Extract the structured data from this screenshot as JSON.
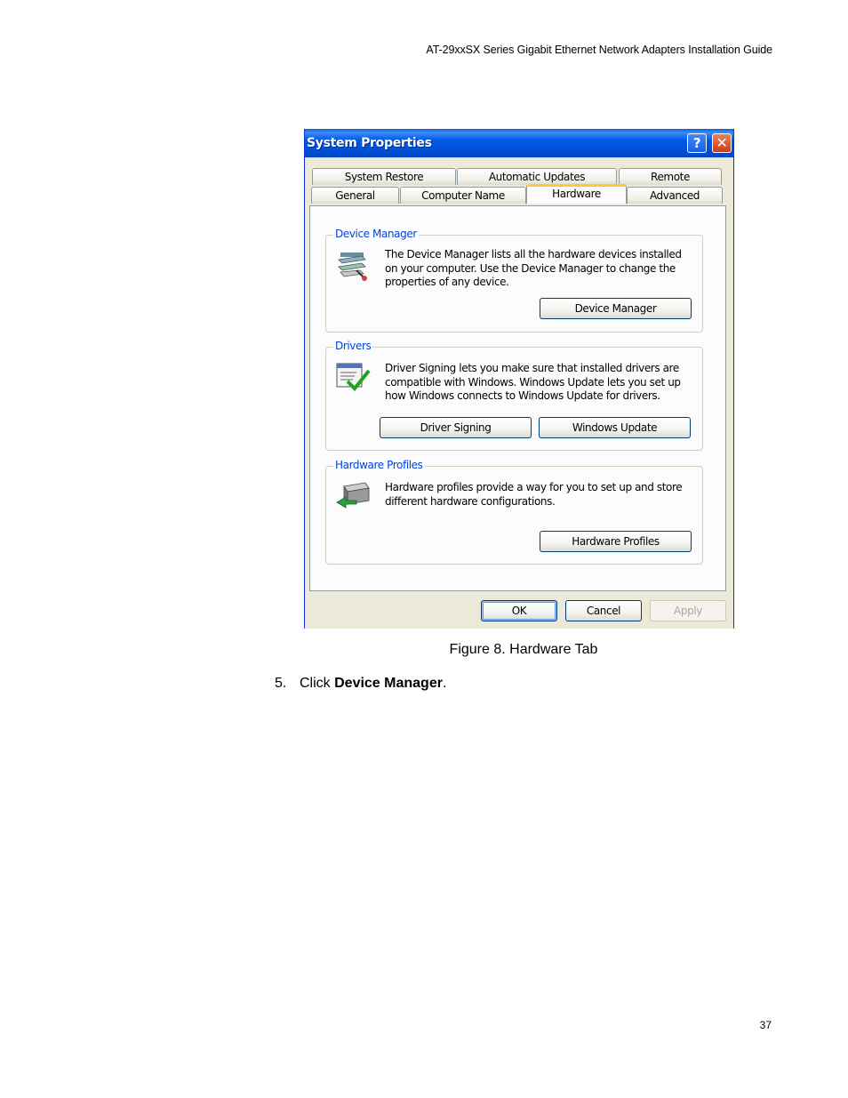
{
  "page": {
    "header": "AT-29xxSX Series Gigabit Ethernet Network Adapters Installation Guide",
    "caption": "Figure 8. Hardware Tab",
    "step_number": "5.",
    "step_prefix": "Click ",
    "step_bold": "Device Manager",
    "step_suffix": ".",
    "page_number": "37"
  },
  "dialog": {
    "title": "System Properties",
    "help_glyph": "?",
    "close_glyph": "✕",
    "tabs_row1": [
      "System Restore",
      "Automatic Updates",
      "Remote"
    ],
    "tabs_row2": [
      "General",
      "Computer Name",
      "Hardware",
      "Advanced"
    ],
    "active_tab": "Hardware",
    "groups": {
      "device_manager": {
        "label": "Device Manager",
        "text": "The Device Manager lists all the hardware devices installed on your computer. Use the Device Manager to change the properties of any device.",
        "button": "Device Manager",
        "icon": "device-manager-icon"
      },
      "drivers": {
        "label": "Drivers",
        "text": "Driver Signing lets you make sure that installed drivers are compatible with Windows. Windows Update lets you set up how Windows connects to Windows Update for drivers.",
        "button_signing": "Driver Signing",
        "button_update": "Windows Update",
        "icon": "driver-signing-icon"
      },
      "profiles": {
        "label": "Hardware Profiles",
        "text": "Hardware profiles provide a way for you to set up and store different hardware configurations.",
        "button": "Hardware Profiles",
        "icon": "hardware-profiles-icon"
      }
    },
    "buttons": {
      "ok": "OK",
      "cancel": "Cancel",
      "apply": "Apply"
    },
    "colors": {
      "titlebar": "#0058e6",
      "group_label": "#0046d5",
      "tab_highlight": "#ffc83c"
    }
  }
}
